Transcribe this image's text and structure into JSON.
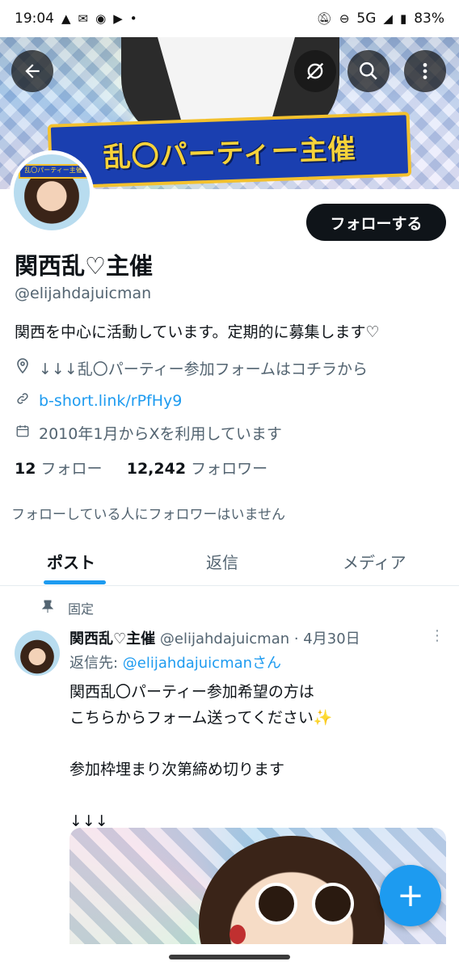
{
  "status_bar": {
    "time": "19:04",
    "network": "5G",
    "battery": "83%"
  },
  "header": {
    "banner_text": "乱〇パーティー主催",
    "back_icon": "arrow-left-icon",
    "icons": [
      "arrow-left-icon",
      "sync-off-icon",
      "search-icon",
      "more-vertical-icon"
    ]
  },
  "profile": {
    "avatar_text": "乱〇パーティー主催",
    "follow_button": "フォローする",
    "name": "関西乱♡主催",
    "handle": "@elijahdajuicman",
    "bio": "関西を中心に活動しています。定期的に募集します♡",
    "location": "↓↓↓乱〇パーティー参加フォームはコチラから",
    "link": "b-short.link/rPfHy9",
    "joined": "2010年1月からXを利用しています",
    "following_count": "12",
    "following_label": "フォロー",
    "followers_count": "12,242",
    "followers_label": "フォロワー",
    "no_mutual": "フォローしている人にフォロワーはいません"
  },
  "tabs": [
    {
      "label": "ポスト"
    },
    {
      "label": "返信"
    },
    {
      "label": "メディア"
    }
  ],
  "post": {
    "pinned_label": "固定",
    "author_name": "関西乱♡主催",
    "author_handle_date": "@elijahdajuicman · 4月30日",
    "reply_prefix": "返信先: ",
    "reply_to": "@elijahdajuicmanさん",
    "lines": [
      "関西乱〇パーティー参加希望の方は",
      "こちらからフォーム送ってください✨",
      "",
      "参加枠埋まり次第締め切ります",
      "",
      "↓↓↓"
    ]
  },
  "fab": {
    "label": "+"
  },
  "colors": {
    "accent": "#1d9bf0",
    "text": "#0f1419",
    "muted": "#536471"
  }
}
